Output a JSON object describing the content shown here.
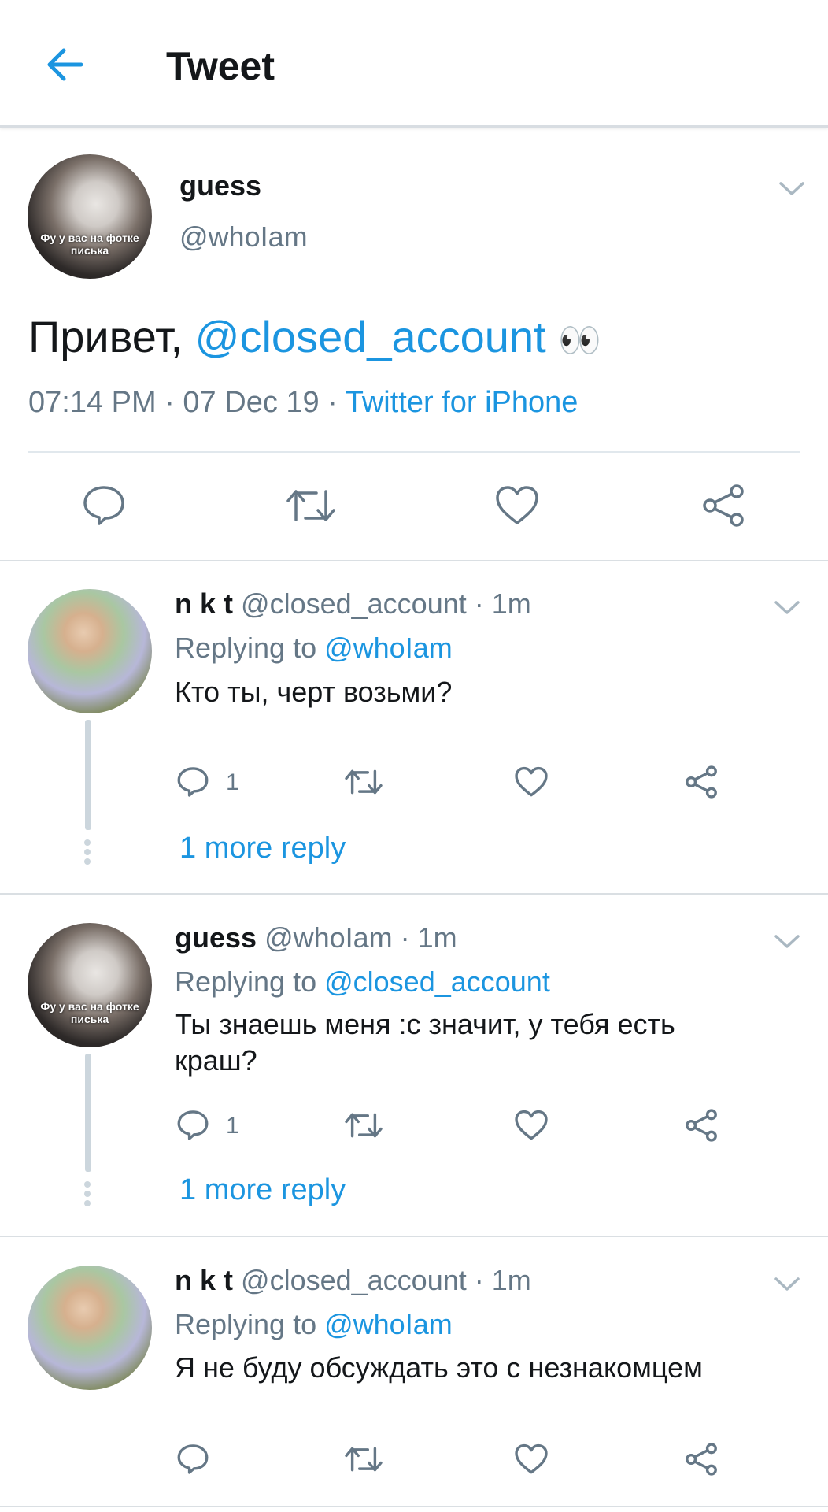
{
  "header": {
    "title": "Tweet"
  },
  "main_tweet": {
    "name": "guess",
    "handle": "@whoIam",
    "avatar_caption": "Фу у вас на фотке писька",
    "text_prefix": "Привет, ",
    "mention": "@closed_account",
    "emoji": "👀",
    "time": "07:14 PM · 07 Dec 19 · ",
    "source": "Twitter for iPhone"
  },
  "replies": [
    {
      "name": "n k t",
      "handle_time": "@closed_account · 1m",
      "replying_label": "Replying to ",
      "replying_to": "@whoIam",
      "text": "Кто ты, черт возьми?",
      "reply_count": "1",
      "more_replies": "1 more reply"
    },
    {
      "name": "guess",
      "handle_time": "@whoIam · 1m",
      "replying_label": "Replying to ",
      "replying_to": "@closed_account",
      "avatar_caption": "Фу у вас на фотке писька",
      "text": "Ты знаешь меня :с значит, у тебя есть краш?",
      "reply_count": "1",
      "more_replies": "1 more reply"
    },
    {
      "name": "n k t",
      "handle_time": "@closed_account · 1m",
      "replying_label": "Replying to ",
      "replying_to": "@whoIam",
      "text": "Я не буду обсуждать это с незнакомцем"
    }
  ],
  "colors": {
    "link": "#1b95e0",
    "secondary": "#657786",
    "divider": "#e1e8ed"
  }
}
